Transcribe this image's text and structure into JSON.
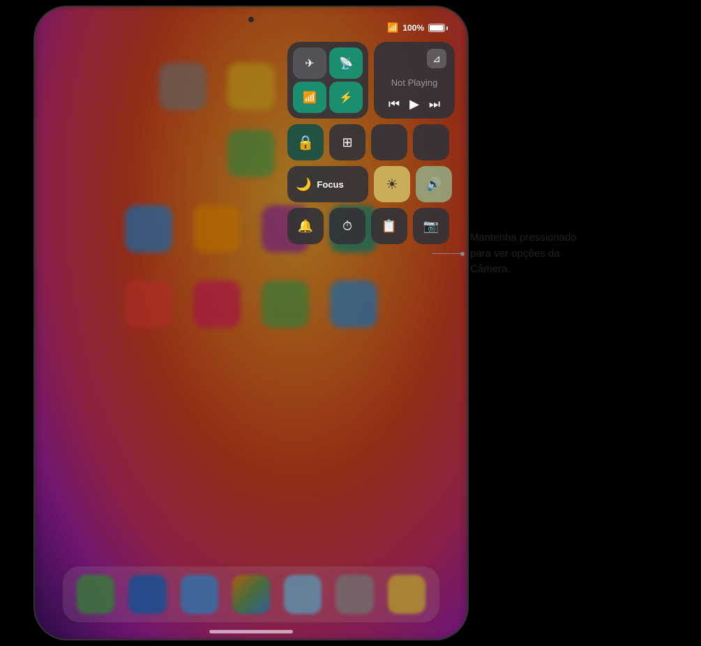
{
  "ipad": {
    "status_bar": {
      "wifi_label": "WiFi",
      "battery_percent": "100%"
    },
    "control_center": {
      "connectivity": {
        "airplane_label": "Airplane",
        "cellular_label": "Cellular",
        "wifi_label": "Wi-Fi",
        "bluetooth_label": "Bluetooth"
      },
      "now_playing": {
        "not_playing_text": "Not Playing",
        "rewind_label": "⏮",
        "play_label": "▶",
        "forward_label": "⏭"
      },
      "lock_rotation_label": "🔒",
      "mirror_label": "⊞",
      "focus_label": "Focus",
      "moon_icon": "🌙",
      "brightness_label": "☀",
      "volume_label": "🔊",
      "alarm_label": "🔔",
      "timer_label": "⏱",
      "notes_label": "📋",
      "camera_label": "📷"
    },
    "callout_text": "Mantenha pressionado\npara ver opções da\nCâmera."
  }
}
